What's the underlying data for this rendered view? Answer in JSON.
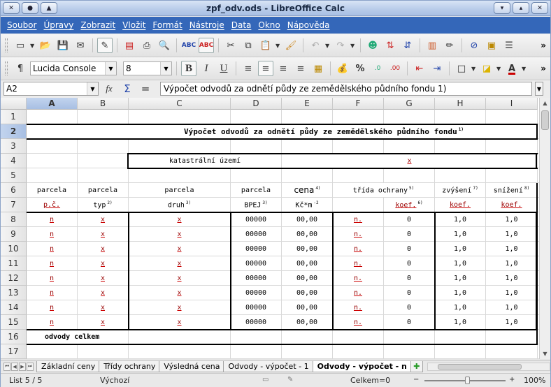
{
  "window": {
    "title": "zpf_odv.ods - LibreOffice Calc"
  },
  "menu": [
    "Soubor",
    "Úpravy",
    "Zobrazit",
    "Vložit",
    "Formát",
    "Nástroje",
    "Data",
    "Okno",
    "Nápověda"
  ],
  "format": {
    "font_name": "Lucida Console",
    "font_size": "8"
  },
  "formula": {
    "cell_ref": "A2",
    "content": "Výpočet odvodů za odnětí půdy ze zemědělského půdního fondu 1)"
  },
  "columns": [
    "A",
    "B",
    "C",
    "D",
    "E",
    "F",
    "G",
    "H",
    "I"
  ],
  "rows": [
    "1",
    "2",
    "3",
    "4",
    "5",
    "6",
    "7",
    "8",
    "9",
    "10",
    "11",
    "12",
    "13",
    "14",
    "15",
    "16",
    "17"
  ],
  "sheet": {
    "title": "Výpočet odvodů za odnětí půdy ze zemědělského půdního fondu",
    "title_note": "1)",
    "katastr_label": "katastrální území",
    "katastr_value": "x",
    "header_row6": {
      "a": "parcela",
      "b": "parcela",
      "c": "parcela",
      "d": "parcela",
      "e": "cena",
      "e_note": "4)",
      "fg": "třída ochrany",
      "fg_note": "5)",
      "h": "zvýšení",
      "h_note": "7)",
      "i": "snížení",
      "i_note": "8)"
    },
    "header_row7": {
      "a": "p.č.",
      "b": "typ",
      "b_note": "2)",
      "c": "druh",
      "c_note": "3)",
      "d": "BPEJ",
      "d_note": "3)",
      "e": "Kč*m",
      "e_note": "-2",
      "g": "koef.",
      "g_note": "6)",
      "h": "koef.",
      "i": "koef."
    },
    "data_rows": [
      {
        "a": "n",
        "b": "x",
        "c": "x",
        "d": "00000",
        "e": "00,00",
        "f": "n.",
        "g": "0",
        "h": "1,0",
        "i": "1,0"
      },
      {
        "a": "n",
        "b": "x",
        "c": "x",
        "d": "00000",
        "e": "00,00",
        "f": "n.",
        "g": "0",
        "h": "1,0",
        "i": "1,0"
      },
      {
        "a": "n",
        "b": "x",
        "c": "x",
        "d": "00000",
        "e": "00,00",
        "f": "n.",
        "g": "0",
        "h": "1,0",
        "i": "1,0"
      },
      {
        "a": "n",
        "b": "x",
        "c": "x",
        "d": "00000",
        "e": "00,00",
        "f": "n.",
        "g": "0",
        "h": "1,0",
        "i": "1,0"
      },
      {
        "a": "n",
        "b": "x",
        "c": "x",
        "d": "00000",
        "e": "00,00",
        "f": "n.",
        "g": "0",
        "h": "1,0",
        "i": "1,0"
      },
      {
        "a": "n",
        "b": "x",
        "c": "x",
        "d": "00000",
        "e": "00,00",
        "f": "n.",
        "g": "0",
        "h": "1,0",
        "i": "1,0"
      },
      {
        "a": "n",
        "b": "x",
        "c": "x",
        "d": "00000",
        "e": "00,00",
        "f": "n.",
        "g": "0",
        "h": "1,0",
        "i": "1,0"
      },
      {
        "a": "n",
        "b": "x",
        "c": "x",
        "d": "00000",
        "e": "00,00",
        "f": "n.",
        "g": "0",
        "h": "1,0",
        "i": "1,0"
      }
    ],
    "total_label": "odvody celkem"
  },
  "tabs": [
    "Základní ceny",
    "Třídy ochrany",
    "Výsledná cena",
    "Odvody - výpočet - 1",
    "Odvody - výpočet - n"
  ],
  "status": {
    "sheet": "List 5 / 5",
    "style": "Výchozí",
    "sum": "Celkem=0",
    "zoom": "100%"
  },
  "colors": {
    "menubar": "#3467b9",
    "accent_underline": "#c00000"
  }
}
